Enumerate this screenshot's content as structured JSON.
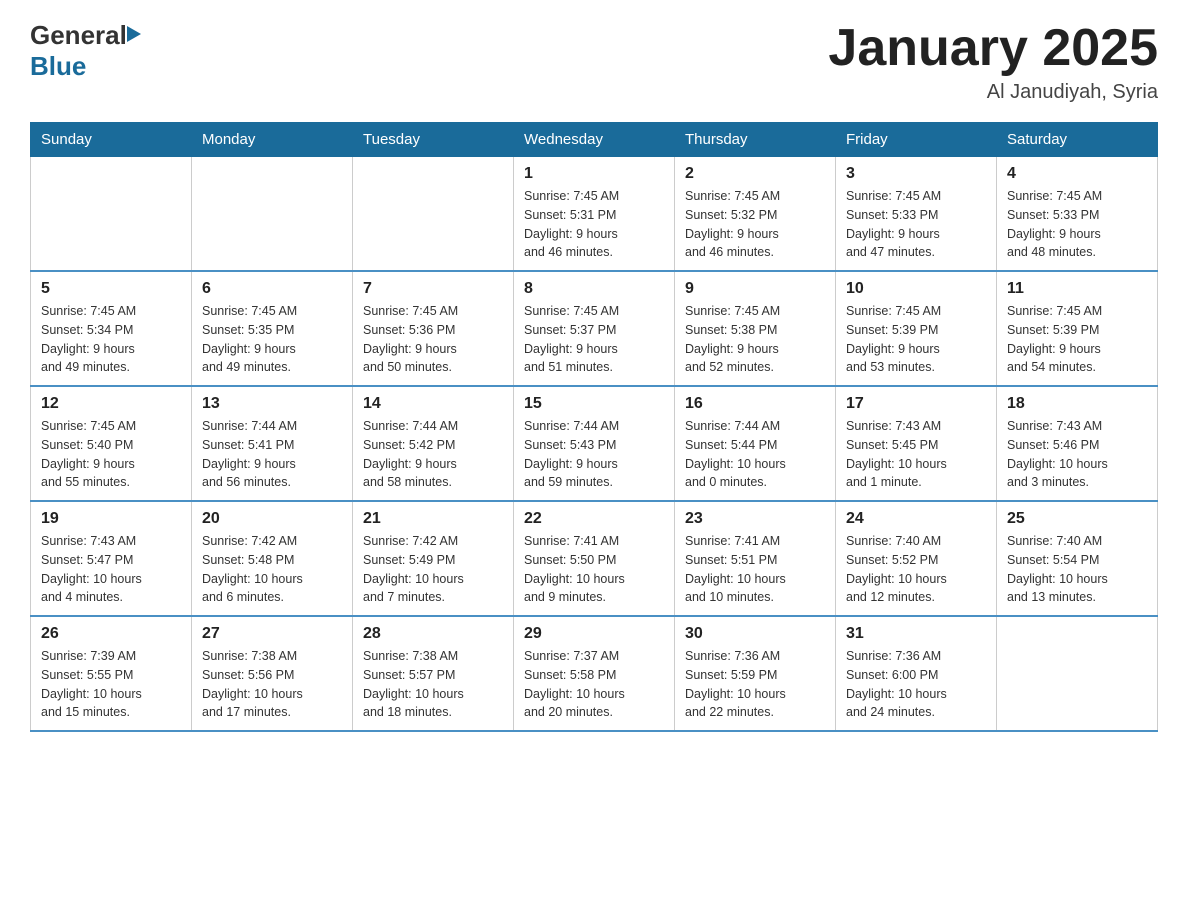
{
  "header": {
    "logo_general": "General",
    "logo_blue": "Blue",
    "title": "January 2025",
    "subtitle": "Al Janudiyah, Syria"
  },
  "days_of_week": [
    "Sunday",
    "Monday",
    "Tuesday",
    "Wednesday",
    "Thursday",
    "Friday",
    "Saturday"
  ],
  "weeks": [
    [
      {
        "number": "",
        "info": ""
      },
      {
        "number": "",
        "info": ""
      },
      {
        "number": "",
        "info": ""
      },
      {
        "number": "1",
        "info": "Sunrise: 7:45 AM\nSunset: 5:31 PM\nDaylight: 9 hours\nand 46 minutes."
      },
      {
        "number": "2",
        "info": "Sunrise: 7:45 AM\nSunset: 5:32 PM\nDaylight: 9 hours\nand 46 minutes."
      },
      {
        "number": "3",
        "info": "Sunrise: 7:45 AM\nSunset: 5:33 PM\nDaylight: 9 hours\nand 47 minutes."
      },
      {
        "number": "4",
        "info": "Sunrise: 7:45 AM\nSunset: 5:33 PM\nDaylight: 9 hours\nand 48 minutes."
      }
    ],
    [
      {
        "number": "5",
        "info": "Sunrise: 7:45 AM\nSunset: 5:34 PM\nDaylight: 9 hours\nand 49 minutes."
      },
      {
        "number": "6",
        "info": "Sunrise: 7:45 AM\nSunset: 5:35 PM\nDaylight: 9 hours\nand 49 minutes."
      },
      {
        "number": "7",
        "info": "Sunrise: 7:45 AM\nSunset: 5:36 PM\nDaylight: 9 hours\nand 50 minutes."
      },
      {
        "number": "8",
        "info": "Sunrise: 7:45 AM\nSunset: 5:37 PM\nDaylight: 9 hours\nand 51 minutes."
      },
      {
        "number": "9",
        "info": "Sunrise: 7:45 AM\nSunset: 5:38 PM\nDaylight: 9 hours\nand 52 minutes."
      },
      {
        "number": "10",
        "info": "Sunrise: 7:45 AM\nSunset: 5:39 PM\nDaylight: 9 hours\nand 53 minutes."
      },
      {
        "number": "11",
        "info": "Sunrise: 7:45 AM\nSunset: 5:39 PM\nDaylight: 9 hours\nand 54 minutes."
      }
    ],
    [
      {
        "number": "12",
        "info": "Sunrise: 7:45 AM\nSunset: 5:40 PM\nDaylight: 9 hours\nand 55 minutes."
      },
      {
        "number": "13",
        "info": "Sunrise: 7:44 AM\nSunset: 5:41 PM\nDaylight: 9 hours\nand 56 minutes."
      },
      {
        "number": "14",
        "info": "Sunrise: 7:44 AM\nSunset: 5:42 PM\nDaylight: 9 hours\nand 58 minutes."
      },
      {
        "number": "15",
        "info": "Sunrise: 7:44 AM\nSunset: 5:43 PM\nDaylight: 9 hours\nand 59 minutes."
      },
      {
        "number": "16",
        "info": "Sunrise: 7:44 AM\nSunset: 5:44 PM\nDaylight: 10 hours\nand 0 minutes."
      },
      {
        "number": "17",
        "info": "Sunrise: 7:43 AM\nSunset: 5:45 PM\nDaylight: 10 hours\nand 1 minute."
      },
      {
        "number": "18",
        "info": "Sunrise: 7:43 AM\nSunset: 5:46 PM\nDaylight: 10 hours\nand 3 minutes."
      }
    ],
    [
      {
        "number": "19",
        "info": "Sunrise: 7:43 AM\nSunset: 5:47 PM\nDaylight: 10 hours\nand 4 minutes."
      },
      {
        "number": "20",
        "info": "Sunrise: 7:42 AM\nSunset: 5:48 PM\nDaylight: 10 hours\nand 6 minutes."
      },
      {
        "number": "21",
        "info": "Sunrise: 7:42 AM\nSunset: 5:49 PM\nDaylight: 10 hours\nand 7 minutes."
      },
      {
        "number": "22",
        "info": "Sunrise: 7:41 AM\nSunset: 5:50 PM\nDaylight: 10 hours\nand 9 minutes."
      },
      {
        "number": "23",
        "info": "Sunrise: 7:41 AM\nSunset: 5:51 PM\nDaylight: 10 hours\nand 10 minutes."
      },
      {
        "number": "24",
        "info": "Sunrise: 7:40 AM\nSunset: 5:52 PM\nDaylight: 10 hours\nand 12 minutes."
      },
      {
        "number": "25",
        "info": "Sunrise: 7:40 AM\nSunset: 5:54 PM\nDaylight: 10 hours\nand 13 minutes."
      }
    ],
    [
      {
        "number": "26",
        "info": "Sunrise: 7:39 AM\nSunset: 5:55 PM\nDaylight: 10 hours\nand 15 minutes."
      },
      {
        "number": "27",
        "info": "Sunrise: 7:38 AM\nSunset: 5:56 PM\nDaylight: 10 hours\nand 17 minutes."
      },
      {
        "number": "28",
        "info": "Sunrise: 7:38 AM\nSunset: 5:57 PM\nDaylight: 10 hours\nand 18 minutes."
      },
      {
        "number": "29",
        "info": "Sunrise: 7:37 AM\nSunset: 5:58 PM\nDaylight: 10 hours\nand 20 minutes."
      },
      {
        "number": "30",
        "info": "Sunrise: 7:36 AM\nSunset: 5:59 PM\nDaylight: 10 hours\nand 22 minutes."
      },
      {
        "number": "31",
        "info": "Sunrise: 7:36 AM\nSunset: 6:00 PM\nDaylight: 10 hours\nand 24 minutes."
      },
      {
        "number": "",
        "info": ""
      }
    ]
  ]
}
